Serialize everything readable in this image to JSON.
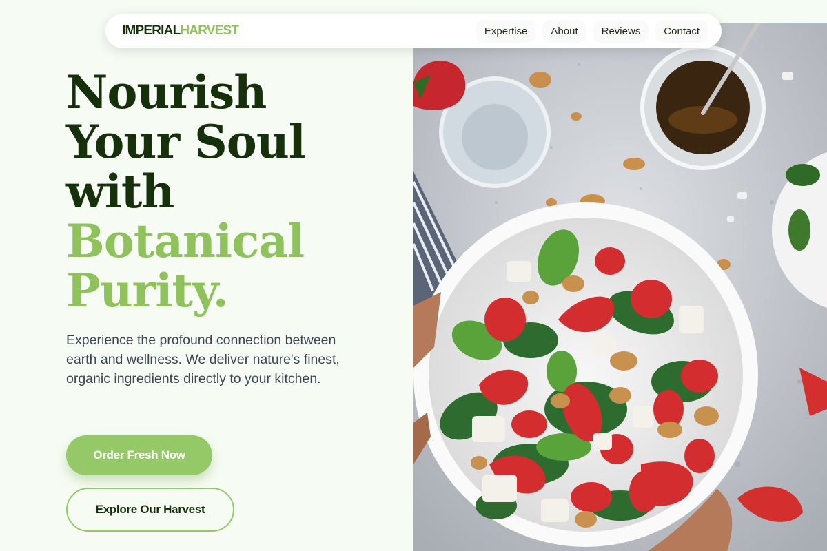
{
  "brand": {
    "part1": "IMPERIAL",
    "part2": "HARVEST"
  },
  "nav": {
    "items": [
      "Expertise",
      "About",
      "Reviews",
      "Contact"
    ]
  },
  "hero": {
    "headline_dark": [
      "Nourish",
      "Your Soul",
      "with"
    ],
    "headline_green": [
      "Botanical",
      "Purity."
    ],
    "description": "Experience the profound connection between earth and wellness. We deliver nature's finest, organic ingredients directly to your kitchen.",
    "primary_cta": "Order Fresh Now",
    "secondary_cta": "Explore Our Harvest"
  },
  "colors": {
    "brand_dark": "#16300c",
    "brand_green": "#8fc25b",
    "background": "#f6fcf4"
  }
}
